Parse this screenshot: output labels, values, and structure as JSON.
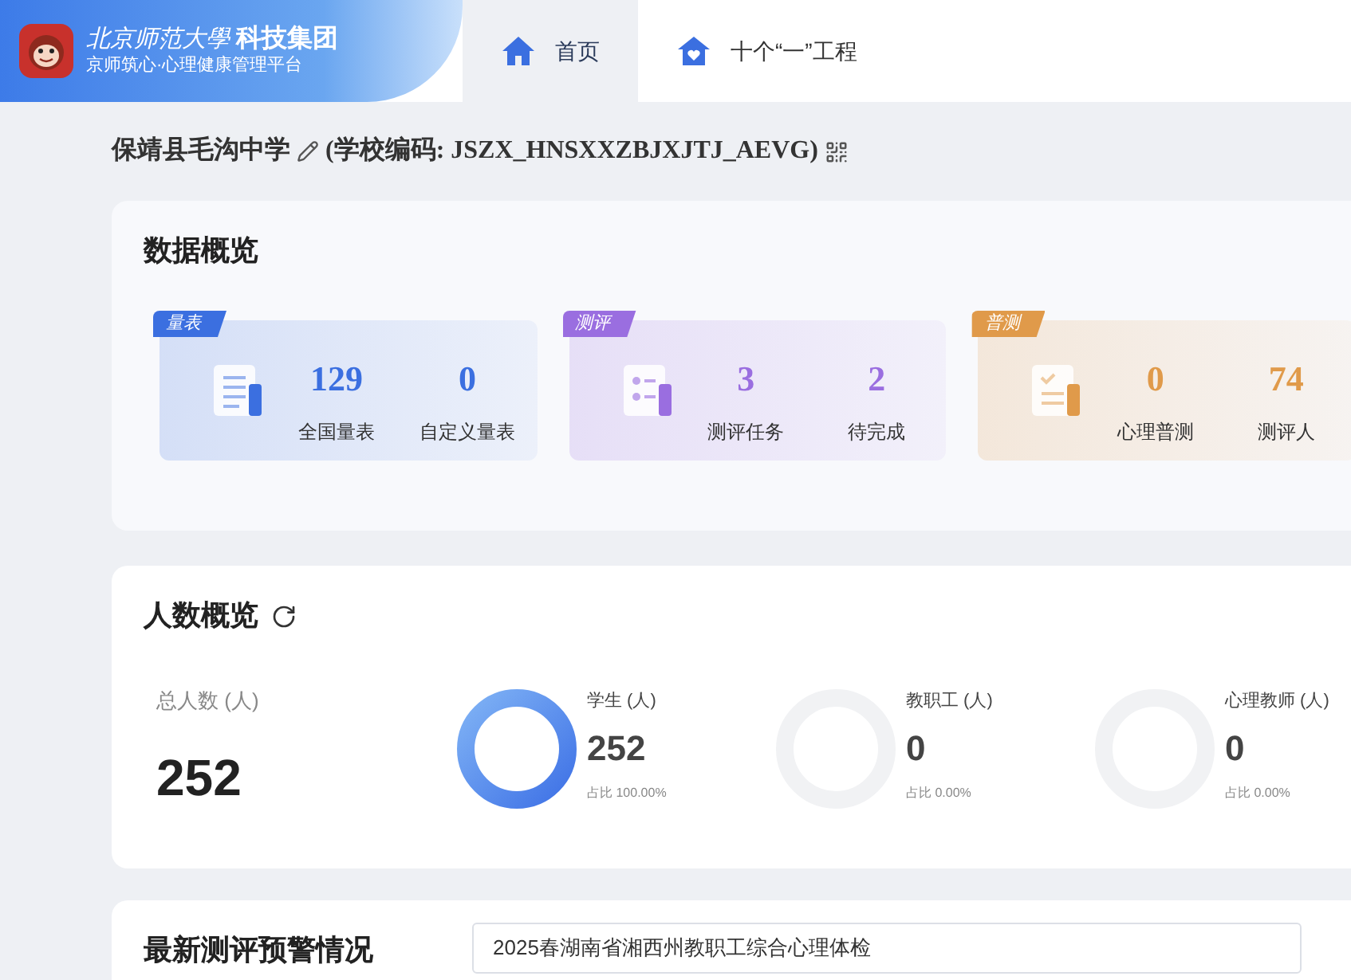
{
  "brand": {
    "university": "北京师范大學",
    "group": "科技集团",
    "subtitle": "京师筑心·心理健康管理平台"
  },
  "tabs": [
    {
      "label": "首页",
      "selected": true,
      "kind": "home"
    },
    {
      "label": "十个“一”工程",
      "selected": false,
      "kind": "heart"
    }
  ],
  "school": {
    "name": "保靖县毛沟中学",
    "code": "(学校编码: JSZX_HNSXXZBJXJTJ_AEVG)"
  },
  "data_overview": {
    "title": "数据概览",
    "groups": [
      {
        "tag": "量表",
        "color": "#3b6fe0",
        "kind": "document",
        "stats": [
          {
            "value": "129",
            "label": "全国量表"
          },
          {
            "value": "0",
            "label": "自定义量表"
          }
        ]
      },
      {
        "tag": "测评",
        "color": "#9a6ee0",
        "kind": "checklist",
        "stats": [
          {
            "value": "3",
            "label": "测评任务"
          },
          {
            "value": "2",
            "label": "待完成"
          }
        ]
      },
      {
        "tag": "普测",
        "color": "#e09a4a",
        "kind": "clipboard",
        "stats": [
          {
            "value": "0",
            "label": "心理普测"
          },
          {
            "value": "74",
            "label": "测评人"
          }
        ]
      }
    ]
  },
  "people_overview": {
    "title": "人数概览",
    "total": {
      "label": "总人数 (人)",
      "value": "252"
    },
    "categories": [
      {
        "label": "学生 (人)",
        "value": "252",
        "share": "占比 100.00%",
        "ring_filled": true
      },
      {
        "label": "教职工 (人)",
        "value": "0",
        "share": "占比 0.00%",
        "ring_filled": false
      },
      {
        "label": "心理教师 (人)",
        "value": "0",
        "share": "占比 0.00%",
        "ring_filled": false
      }
    ]
  },
  "warning": {
    "title": "最新测评预警情况",
    "select": "2025春湖南省湘西州教职工综合心理体检"
  }
}
